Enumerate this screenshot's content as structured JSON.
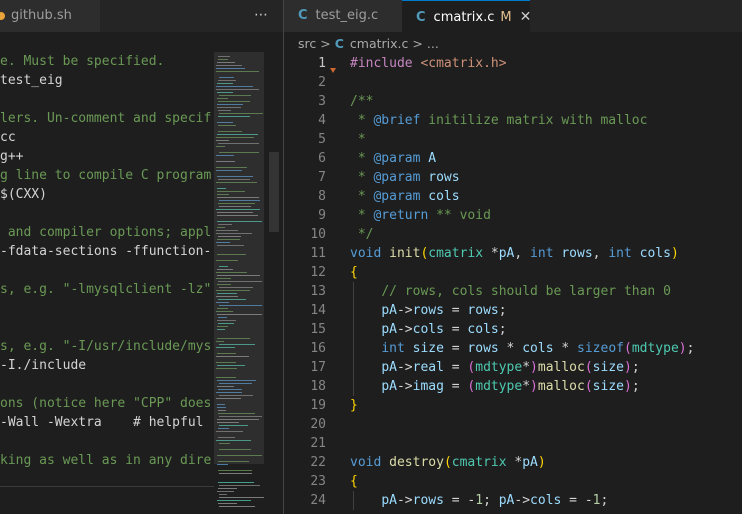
{
  "left": {
    "tab_title": "github.sh",
    "more_label": "⋯",
    "lines": [
      "e. Must be specified.",
      "test_eig",
      "",
      "lers. Un-comment and specif",
      "cc",
      "g++",
      "g line to compile C program",
      "$(CXX)",
      "",
      " and compiler options; appl",
      "-fdata-sections -ffunction-",
      "",
      "s, e.g. \"-lmysqlclient -lz\"",
      "",
      "",
      "s, e.g. \"-I/usr/include/mys",
      "-I./include",
      "",
      "ons (notice here \"CPP\" does",
      "-Wall -Wextra    # helpful",
      "",
      "king as well as in any dire"
    ]
  },
  "right": {
    "tabs": [
      {
        "icon": "C",
        "label": "test_eig.c"
      },
      {
        "icon": "C",
        "label": "cmatrix.c",
        "modified": "M",
        "close": "✕"
      }
    ],
    "breadcrumb": {
      "root": "src",
      "sep": ">",
      "icon": "C",
      "file": "cmatrix.c",
      "sep2": ">",
      "ellipsis": "..."
    },
    "line_numbers": [
      "1",
      "2",
      "3",
      "4",
      "5",
      "6",
      "7",
      "8",
      "9",
      "10",
      "11",
      "12",
      "13",
      "14",
      "15",
      "16",
      "17",
      "18",
      "19",
      "20",
      "21",
      "22",
      "23",
      "24"
    ]
  },
  "colors": {
    "accent": "#007acc",
    "keyword": "#569cd6",
    "type": "#4ec9b0",
    "comment": "#6a9955",
    "string": "#ce9178",
    "function": "#dcdcaa",
    "preprocessor": "#c586c0",
    "variable": "#9cdcfe"
  }
}
